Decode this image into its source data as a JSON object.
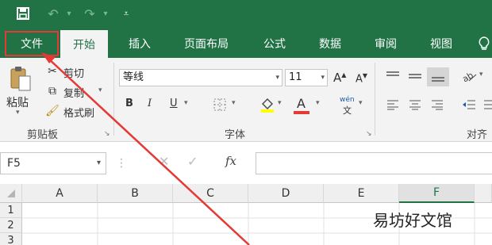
{
  "quick_access": {
    "save": "save-icon",
    "undo": "undo-icon",
    "redo": "redo-icon",
    "more": "customize-icon"
  },
  "tabs": [
    "文件",
    "开始",
    "插入",
    "页面布局",
    "公式",
    "数据",
    "审阅",
    "视图"
  ],
  "clipboard": {
    "paste": "粘贴",
    "cut": "剪切",
    "copy": "复制",
    "format_painter": "格式刷",
    "group": "剪贴板"
  },
  "font": {
    "name": "等线",
    "size": "11",
    "group": "字体",
    "grow": "A",
    "shrink": "A",
    "bold": "B",
    "italic": "I",
    "underline": "U",
    "color": "A",
    "phonetic_top": "wén",
    "phonetic_bottom": "文"
  },
  "alignment": {
    "group": "对齐"
  },
  "formula": {
    "name_box": "F5",
    "fx": "fx"
  },
  "columns": [
    "A",
    "B",
    "C",
    "D",
    "E",
    "F"
  ],
  "rows": [
    "1",
    "2",
    "3"
  ],
  "watermark": "易坊好文馆",
  "colors": {
    "accent": "#217346",
    "highlight_arrow": "#e53935"
  }
}
